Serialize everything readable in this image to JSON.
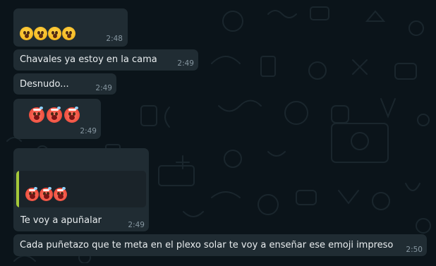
{
  "messages": [
    {
      "type": "emoji",
      "emoji_name": "astonished-face",
      "count": 4,
      "time": "2:48"
    },
    {
      "type": "text",
      "text": "Chavales ya estoy en la cama",
      "time": "2:49"
    },
    {
      "type": "text",
      "text": "Desnudo...",
      "time": "2:49"
    },
    {
      "type": "emoji",
      "emoji_name": "hot-face",
      "count": 3,
      "time": "2:49"
    },
    {
      "type": "reply",
      "quoted_emoji": "hot-face",
      "quoted_count": 3,
      "text": "Te voy a apuñalar",
      "time": "2:49"
    },
    {
      "type": "text",
      "text": "Cada puñetazo que te meta en el plexo solar te voy a enseñar ese emoji impreso",
      "time": "2:50"
    }
  ],
  "colors": {
    "background": "#0b141a",
    "bubble": "#202c33",
    "quote_box": "#1a2329",
    "quote_bar": "#a5c93a",
    "text": "#e9edef",
    "timestamp": "#8696a0"
  }
}
